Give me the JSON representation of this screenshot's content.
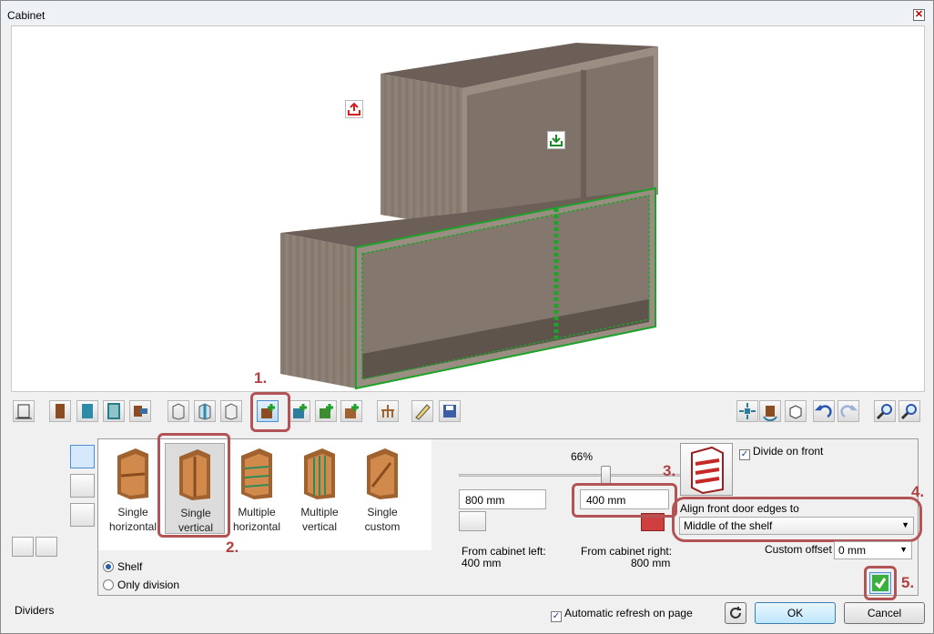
{
  "window": {
    "title": "Cabinet",
    "close_label": "✕"
  },
  "steps": {
    "s1": "1.",
    "s2": "2.",
    "s3": "3.",
    "s4": "4.",
    "s5": "5."
  },
  "gallery": {
    "items": [
      {
        "line1": "Single",
        "line2": "horizontal",
        "selected": false
      },
      {
        "line1": "Single",
        "line2": "vertical",
        "selected": true
      },
      {
        "line1": "Multiple",
        "line2": "horizontal",
        "selected": false
      },
      {
        "line1": "Multiple",
        "line2": "vertical",
        "selected": false
      },
      {
        "line1": "Single",
        "line2": "custom",
        "selected": false
      }
    ]
  },
  "options": {
    "shelf_label": "Shelf",
    "shelf_selected": true,
    "only_division_label": "Only division"
  },
  "slider": {
    "percent_label": "66%",
    "value": 0.66
  },
  "dimensions": {
    "left_value": "800 mm",
    "right_value": "400 mm",
    "from_left_label": "From cabinet left:",
    "from_left_value": "400 mm",
    "from_right_label": "From cabinet right:",
    "from_right_value": "800 mm"
  },
  "front": {
    "divide_on_front_label": "Divide on front",
    "divide_on_front_checked": true,
    "align_label": "Align front door edges to",
    "align_value": "Middle of the shelf",
    "custom_offset_label": "Custom offset",
    "custom_offset_value": "0 mm"
  },
  "footer": {
    "status": "Dividers",
    "auto_refresh_label": "Automatic refresh on page",
    "auto_refresh_checked": true,
    "ok_label": "OK",
    "cancel_label": "Cancel"
  },
  "colors": {
    "accent_red": "#b25455",
    "highlight_green": "#1fa22a",
    "wood": "#8a7d72"
  }
}
